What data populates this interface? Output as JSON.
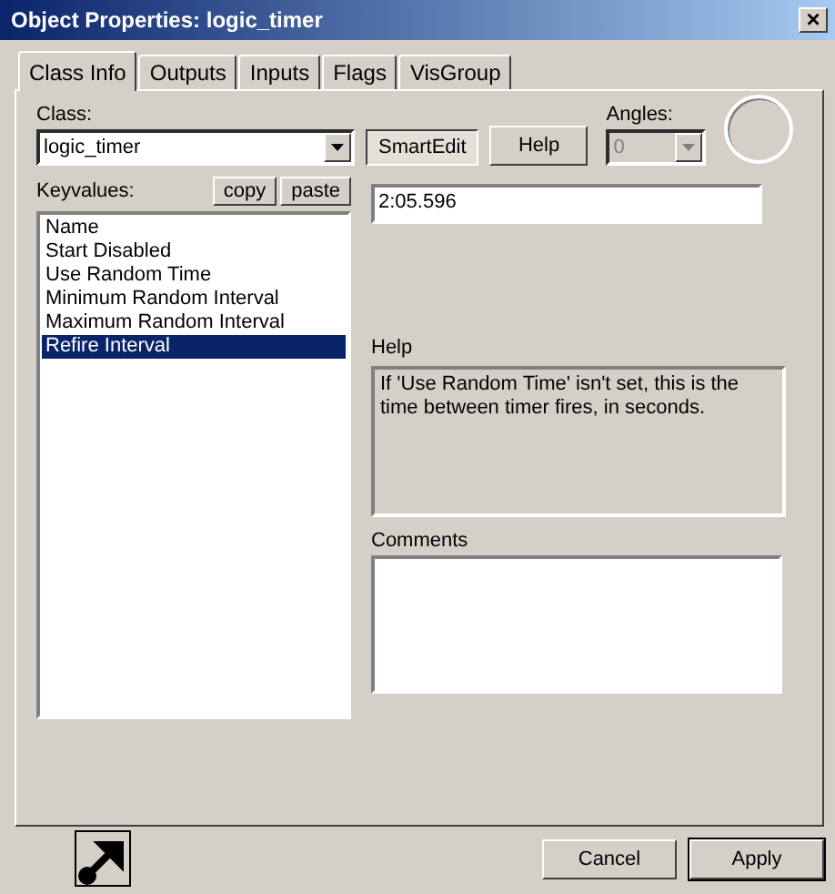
{
  "window": {
    "title": "Object Properties: logic_timer",
    "close": "×"
  },
  "tabs": [
    {
      "label": "Class Info",
      "selected": true
    },
    {
      "label": "Outputs",
      "selected": false
    },
    {
      "label": "Inputs",
      "selected": false
    },
    {
      "label": "Flags",
      "selected": false
    },
    {
      "label": "VisGroup",
      "selected": false
    }
  ],
  "class_field": {
    "label": "Class:",
    "value": "logic_timer"
  },
  "smart_edit_button": {
    "label": "SmartEdit",
    "pressed": true
  },
  "help_button": "Help",
  "angles": {
    "label": "Angles:",
    "value": "0",
    "disabled": true
  },
  "keyvalues": {
    "label": "Keyvalues:",
    "copy": "copy",
    "paste": "paste",
    "items": [
      {
        "label": "Name",
        "selected": false
      },
      {
        "label": "Start Disabled",
        "selected": false
      },
      {
        "label": "Use Random Time",
        "selected": false
      },
      {
        "label": "Minimum Random Interval",
        "selected": false
      },
      {
        "label": "Maximum Random Interval",
        "selected": false
      },
      {
        "label": "Refire Interval",
        "selected": true
      }
    ]
  },
  "value_field": {
    "value": "2:05.596"
  },
  "help": {
    "label": "Help",
    "text": "If 'Use Random Time' isn't set, this is the time between timer fires, in seconds."
  },
  "comments": {
    "label": "Comments"
  },
  "footer_buttons": [
    {
      "label": "Cancel",
      "default": false
    },
    {
      "label": "Apply",
      "default": true
    }
  ]
}
